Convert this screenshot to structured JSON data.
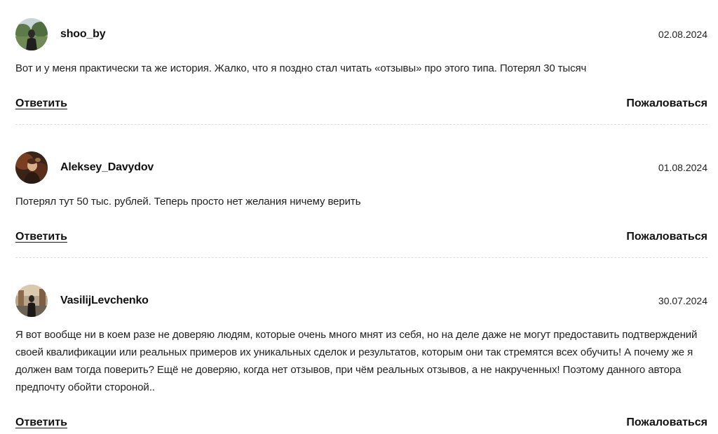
{
  "comments": [
    {
      "username": "shoo_by",
      "date": "02.08.2024",
      "text": "Вот и у меня практически та же история. Жалко, что я поздно стал читать «отзывы» про этого типа. Потерял 30 тысяч",
      "reply_label": "Ответить",
      "report_label": "Пожаловаться",
      "avatar_icon": "user-avatar-photo-park"
    },
    {
      "username": "Aleksey_Davydov",
      "date": "01.08.2024",
      "text": "Потерял тут 50 тыс. рублей. Теперь просто нет желания ничему верить",
      "reply_label": "Ответить",
      "report_label": "Пожаловаться",
      "avatar_icon": "user-avatar-photo-portrait"
    },
    {
      "username": "VasilijLevchenko",
      "date": "30.07.2024",
      "text": "Я вот вообще ни в коем разе не доверяю людям, которые очень много мнят из себя, но на деле даже не могут предоставить подтверждений своей квалификации или реальных примеров их уникальных сделок и результатов, которым они так стремятся всех обучить! А почему же я должен вам тогда поверить? Ещё не доверяю, когда нет отзывов, при чём реальных отзывов, а не накрученных! Поэтому данного автора предпочту обойти стороной..",
      "reply_label": "Ответить",
      "report_label": "Пожаловаться",
      "avatar_icon": "user-avatar-photo-street"
    }
  ]
}
